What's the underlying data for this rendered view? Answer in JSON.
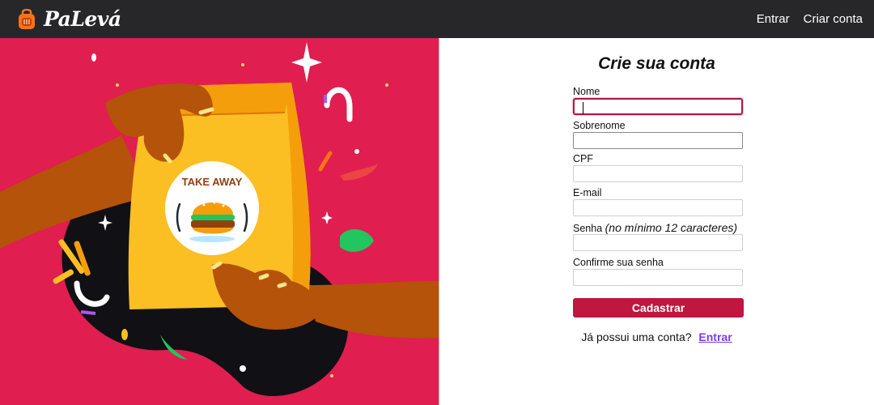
{
  "nav": {
    "brand": "PaLevá",
    "login_label": "Entrar",
    "signup_label": "Criar conta"
  },
  "illustration": {
    "badge_text": "TAKE AWAY"
  },
  "form": {
    "title": "Crie sua conta",
    "fields": [
      {
        "label": "Nome",
        "value": ""
      },
      {
        "label": "Sobrenome",
        "value": ""
      },
      {
        "label": "CPF",
        "value": ""
      },
      {
        "label": "E-mail",
        "value": ""
      },
      {
        "label": "Senha",
        "hint": "(no mínimo 12 caracteres)",
        "value": ""
      },
      {
        "label": "Confirme sua senha",
        "value": ""
      }
    ],
    "submit_label": "Cadastrar",
    "have_account_text": "Já possui uma conta?",
    "login_link": "Entrar"
  },
  "colors": {
    "navbar": "#27272a",
    "hero_background": "#e01e4f",
    "primary": "#c0163f",
    "link": "#7c3aed"
  }
}
